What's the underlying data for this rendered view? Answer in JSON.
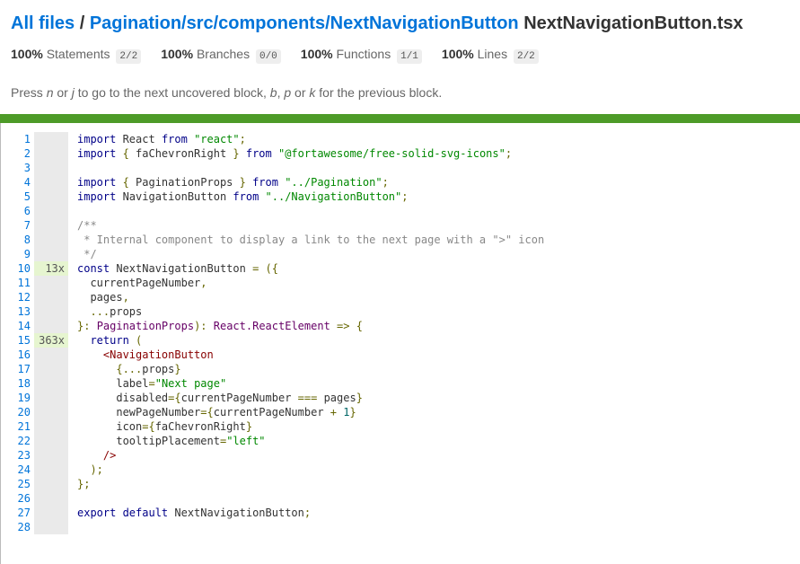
{
  "breadcrumb": {
    "all_files": "All files",
    "separator": " / ",
    "path": "Pagination/src/components/NextNavigationButton",
    "file": "NextNavigationButton.tsx"
  },
  "stats": [
    {
      "pct": "100%",
      "label": "Statements",
      "fraction": "2/2"
    },
    {
      "pct": "100%",
      "label": "Branches",
      "fraction": "0/0"
    },
    {
      "pct": "100%",
      "label": "Functions",
      "fraction": "1/1"
    },
    {
      "pct": "100%",
      "label": "Lines",
      "fraction": "2/2"
    }
  ],
  "hint": {
    "press": "Press ",
    "n": "n",
    "or": " or ",
    "j": "j",
    "next": " to go to the next uncovered block, ",
    "b": "b",
    "comma": ", ",
    "p": "p",
    "or2": " or ",
    "k": "k",
    "prev": " for the previous block."
  },
  "colors": {
    "link": "#0074d9",
    "coverage_high": "#4d9b28",
    "hit_bg": "#e6f5d0"
  },
  "code_lines": [
    {
      "n": "1",
      "hits": "",
      "tokens": [
        [
          "kw",
          "import "
        ],
        [
          "",
          "React "
        ],
        [
          "kw",
          "from "
        ],
        [
          "str",
          "\"react\""
        ],
        [
          "pun",
          ";"
        ]
      ]
    },
    {
      "n": "2",
      "hits": "",
      "tokens": [
        [
          "kw",
          "import "
        ],
        [
          "pun",
          "{ "
        ],
        [
          "",
          "faChevronRight "
        ],
        [
          "pun",
          "} "
        ],
        [
          "kw",
          "from "
        ],
        [
          "str",
          "\"@fortawesome/free-solid-svg-icons\""
        ],
        [
          "pun",
          ";"
        ]
      ]
    },
    {
      "n": "3",
      "hits": "",
      "tokens": []
    },
    {
      "n": "4",
      "hits": "",
      "tokens": [
        [
          "kw",
          "import "
        ],
        [
          "pun",
          "{ "
        ],
        [
          "",
          "PaginationProps "
        ],
        [
          "pun",
          "} "
        ],
        [
          "kw",
          "from "
        ],
        [
          "str",
          "\"../Pagination\""
        ],
        [
          "pun",
          ";"
        ]
      ]
    },
    {
      "n": "5",
      "hits": "",
      "tokens": [
        [
          "kw",
          "import "
        ],
        [
          "",
          "NavigationButton "
        ],
        [
          "kw",
          "from "
        ],
        [
          "str",
          "\"../NavigationButton\""
        ],
        [
          "pun",
          ";"
        ]
      ]
    },
    {
      "n": "6",
      "hits": "",
      "tokens": []
    },
    {
      "n": "7",
      "hits": "",
      "tokens": [
        [
          "cm",
          "/**"
        ]
      ]
    },
    {
      "n": "8",
      "hits": "",
      "tokens": [
        [
          "cm",
          " * Internal component to display a link to the next page with a \">\" icon"
        ]
      ]
    },
    {
      "n": "9",
      "hits": "",
      "tokens": [
        [
          "cm",
          " */"
        ]
      ]
    },
    {
      "n": "10",
      "hits": "13x",
      "tokens": [
        [
          "kw",
          "const "
        ],
        [
          "",
          "NextNavigationButton "
        ],
        [
          "pun",
          "= ({"
        ]
      ]
    },
    {
      "n": "11",
      "hits": "",
      "tokens": [
        [
          "",
          "  currentPageNumber"
        ],
        [
          "pun",
          ","
        ]
      ]
    },
    {
      "n": "12",
      "hits": "",
      "tokens": [
        [
          "",
          "  pages"
        ],
        [
          "pun",
          ","
        ]
      ]
    },
    {
      "n": "13",
      "hits": "",
      "tokens": [
        [
          "pun",
          "  ..."
        ],
        [
          "",
          "props"
        ]
      ]
    },
    {
      "n": "14",
      "hits": "",
      "tokens": [
        [
          "pun",
          "}: "
        ],
        [
          "typ",
          "PaginationProps"
        ],
        [
          "pun",
          "): "
        ],
        [
          "typ",
          "React.ReactElement "
        ],
        [
          "pun",
          "=> {"
        ]
      ]
    },
    {
      "n": "15",
      "hits": "363x",
      "tokens": [
        [
          "kw",
          "  return "
        ],
        [
          "pun",
          "("
        ]
      ]
    },
    {
      "n": "16",
      "hits": "",
      "tokens": [
        [
          "tag",
          "    <NavigationButton"
        ]
      ]
    },
    {
      "n": "17",
      "hits": "",
      "tokens": [
        [
          "pun",
          "      {..."
        ],
        [
          "",
          "props"
        ],
        [
          "pun",
          "}"
        ]
      ]
    },
    {
      "n": "18",
      "hits": "",
      "tokens": [
        [
          "",
          "      label"
        ],
        [
          "pun",
          "="
        ],
        [
          "str",
          "\"Next page\""
        ]
      ]
    },
    {
      "n": "19",
      "hits": "",
      "tokens": [
        [
          "",
          "      disabled"
        ],
        [
          "pun",
          "={"
        ],
        [
          "",
          "currentPageNumber "
        ],
        [
          "pun",
          "=== "
        ],
        [
          "",
          "pages"
        ],
        [
          "pun",
          "}"
        ]
      ]
    },
    {
      "n": "20",
      "hits": "",
      "tokens": [
        [
          "",
          "      newPageNumber"
        ],
        [
          "pun",
          "={"
        ],
        [
          "",
          "currentPageNumber "
        ],
        [
          "pun",
          "+ "
        ],
        [
          "num",
          "1"
        ],
        [
          "pun",
          "}"
        ]
      ]
    },
    {
      "n": "21",
      "hits": "",
      "tokens": [
        [
          "",
          "      icon"
        ],
        [
          "pun",
          "={"
        ],
        [
          "",
          "faChevronRight"
        ],
        [
          "pun",
          "}"
        ]
      ]
    },
    {
      "n": "22",
      "hits": "",
      "tokens": [
        [
          "",
          "      tooltipPlacement"
        ],
        [
          "pun",
          "="
        ],
        [
          "str",
          "\"left\""
        ]
      ]
    },
    {
      "n": "23",
      "hits": "",
      "tokens": [
        [
          "tag",
          "    />"
        ]
      ]
    },
    {
      "n": "24",
      "hits": "",
      "tokens": [
        [
          "pun",
          "  );"
        ]
      ]
    },
    {
      "n": "25",
      "hits": "",
      "tokens": [
        [
          "pun",
          "};"
        ]
      ]
    },
    {
      "n": "26",
      "hits": "",
      "tokens": []
    },
    {
      "n": "27",
      "hits": "",
      "tokens": [
        [
          "kw",
          "export default "
        ],
        [
          "",
          "NextNavigationButton"
        ],
        [
          "pun",
          ";"
        ]
      ]
    },
    {
      "n": "28",
      "hits": "",
      "tokens": []
    }
  ]
}
